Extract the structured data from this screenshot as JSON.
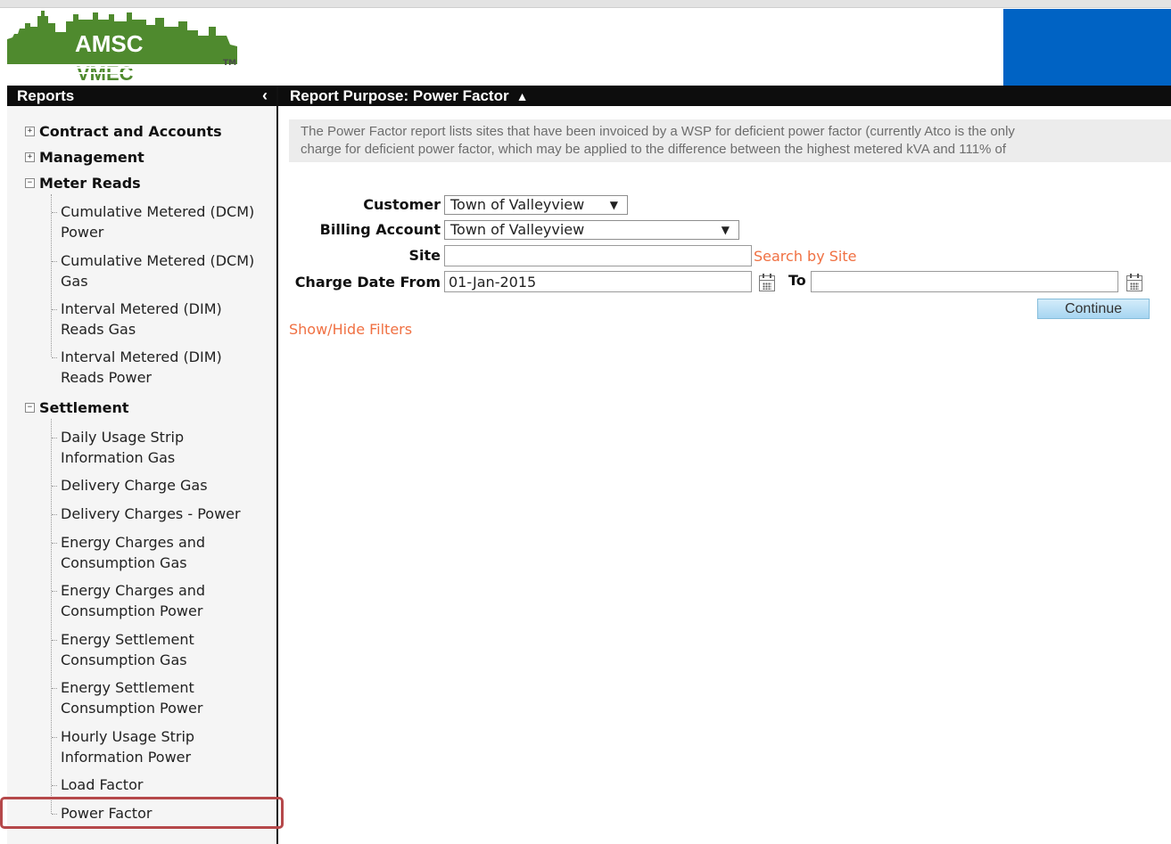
{
  "brand": {
    "logo_text": "AMSC",
    "logo_sub": "VMEC",
    "tm": "TM",
    "accent_color": "#0063c4",
    "logo_color": "#4f8a2e"
  },
  "sidebar": {
    "title": "Reports",
    "collapse_icon": "chevron-left-icon",
    "categories": [
      {
        "label": "Contract and Accounts",
        "state": "collapsed"
      },
      {
        "label": "Management",
        "state": "collapsed"
      },
      {
        "label": "Meter Reads",
        "state": "expanded",
        "items": [
          "Cumulative Metered (DCM) Power",
          "Cumulative Metered (DCM) Gas",
          "Interval Metered (DIM) Reads Gas",
          "Interval Metered (DIM) Reads Power"
        ]
      },
      {
        "label": "Settlement",
        "state": "expanded",
        "items": [
          "Daily Usage Strip Information Gas",
          "Delivery Charge Gas",
          "Delivery Charges - Power",
          "Energy Charges and Consumption Gas",
          "Energy Charges and Consumption Power",
          "Energy Settlement Consumption Gas",
          "Energy Settlement Consumption Power",
          "Hourly Usage Strip Information Power",
          "Load Factor",
          "Power Factor"
        ]
      }
    ],
    "selected": "Power Factor",
    "highlight_color": "#b5484a"
  },
  "main": {
    "header": "Report Purpose: Power Factor",
    "description_line1": "The Power Factor report lists sites that have been invoiced by a WSP for deficient power factor (currently Atco is the only",
    "description_line2": "charge for deficient power factor, which may be applied to the difference between the highest metered kVA and 111% of"
  },
  "form": {
    "customer_label": "Customer",
    "customer_value": "Town of Valleyview",
    "billing_label": "Billing Account",
    "billing_value": "Town of Valleyview",
    "site_label": "Site",
    "site_value": "",
    "search_site_link": "Search by Site",
    "charge_from_label": "Charge Date From",
    "charge_from_value": "01-Jan-2015",
    "to_label": "To",
    "to_value": "",
    "continue_label": "Continue",
    "filters_link": "Show/Hide Filters",
    "link_color": "#f07042"
  }
}
